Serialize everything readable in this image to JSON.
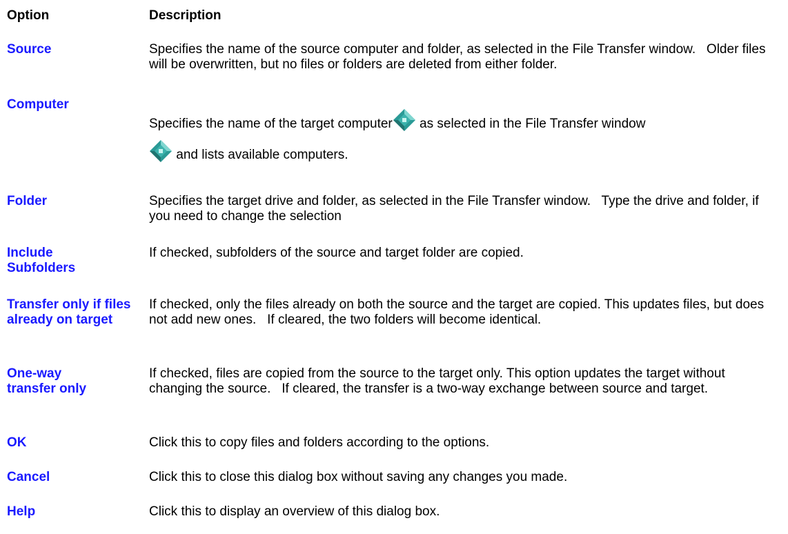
{
  "header": {
    "option_label": "Option",
    "description_label": "Description"
  },
  "rows": [
    {
      "term": "Source",
      "description": "Specifies the name of the source computer and folder, as selected in the File Transfer window.   Older files will be overwritten, but no files or folders are deleted from either folder."
    },
    {
      "term": "Computer",
      "description_part1": "Specifies the name of the target computer",
      "description_part2": " as selected in the File Transfer window",
      "description_part3": " and lists available computers."
    },
    {
      "term": "Folder",
      "description": "Specifies the target drive and folder, as selected in the File Transfer window.   Type the drive and folder, if you need to change the selection"
    },
    {
      "term": "Include Subfolders",
      "description": "If checked, subfolders of the source and target folder are copied."
    },
    {
      "term": "Transfer only if files already on target",
      "description": "If checked, only the files already on both the source and the target are copied. This updates files, but does not add new ones.   If cleared, the two folders will become identical."
    },
    {
      "term": "One-way transfer only",
      "description": "If checked, files are copied from the source to the target only. This option updates the target without changing the source.   If cleared, the transfer is a two-way exchange between source and target."
    },
    {
      "term": "OK",
      "description": "Click this to copy files and folders according to the options."
    },
    {
      "term": "Cancel",
      "description": "Click this to close this dialog box without saving any changes you made."
    },
    {
      "term": "Help",
      "description": "Click this to display an overview of this dialog box."
    }
  ],
  "colors": {
    "link": "#1a1aff",
    "gem_outer": "#2a9a96",
    "gem_inner": "#9be7e2"
  },
  "icons": {
    "popup_marker": "diamond-gem-icon"
  }
}
